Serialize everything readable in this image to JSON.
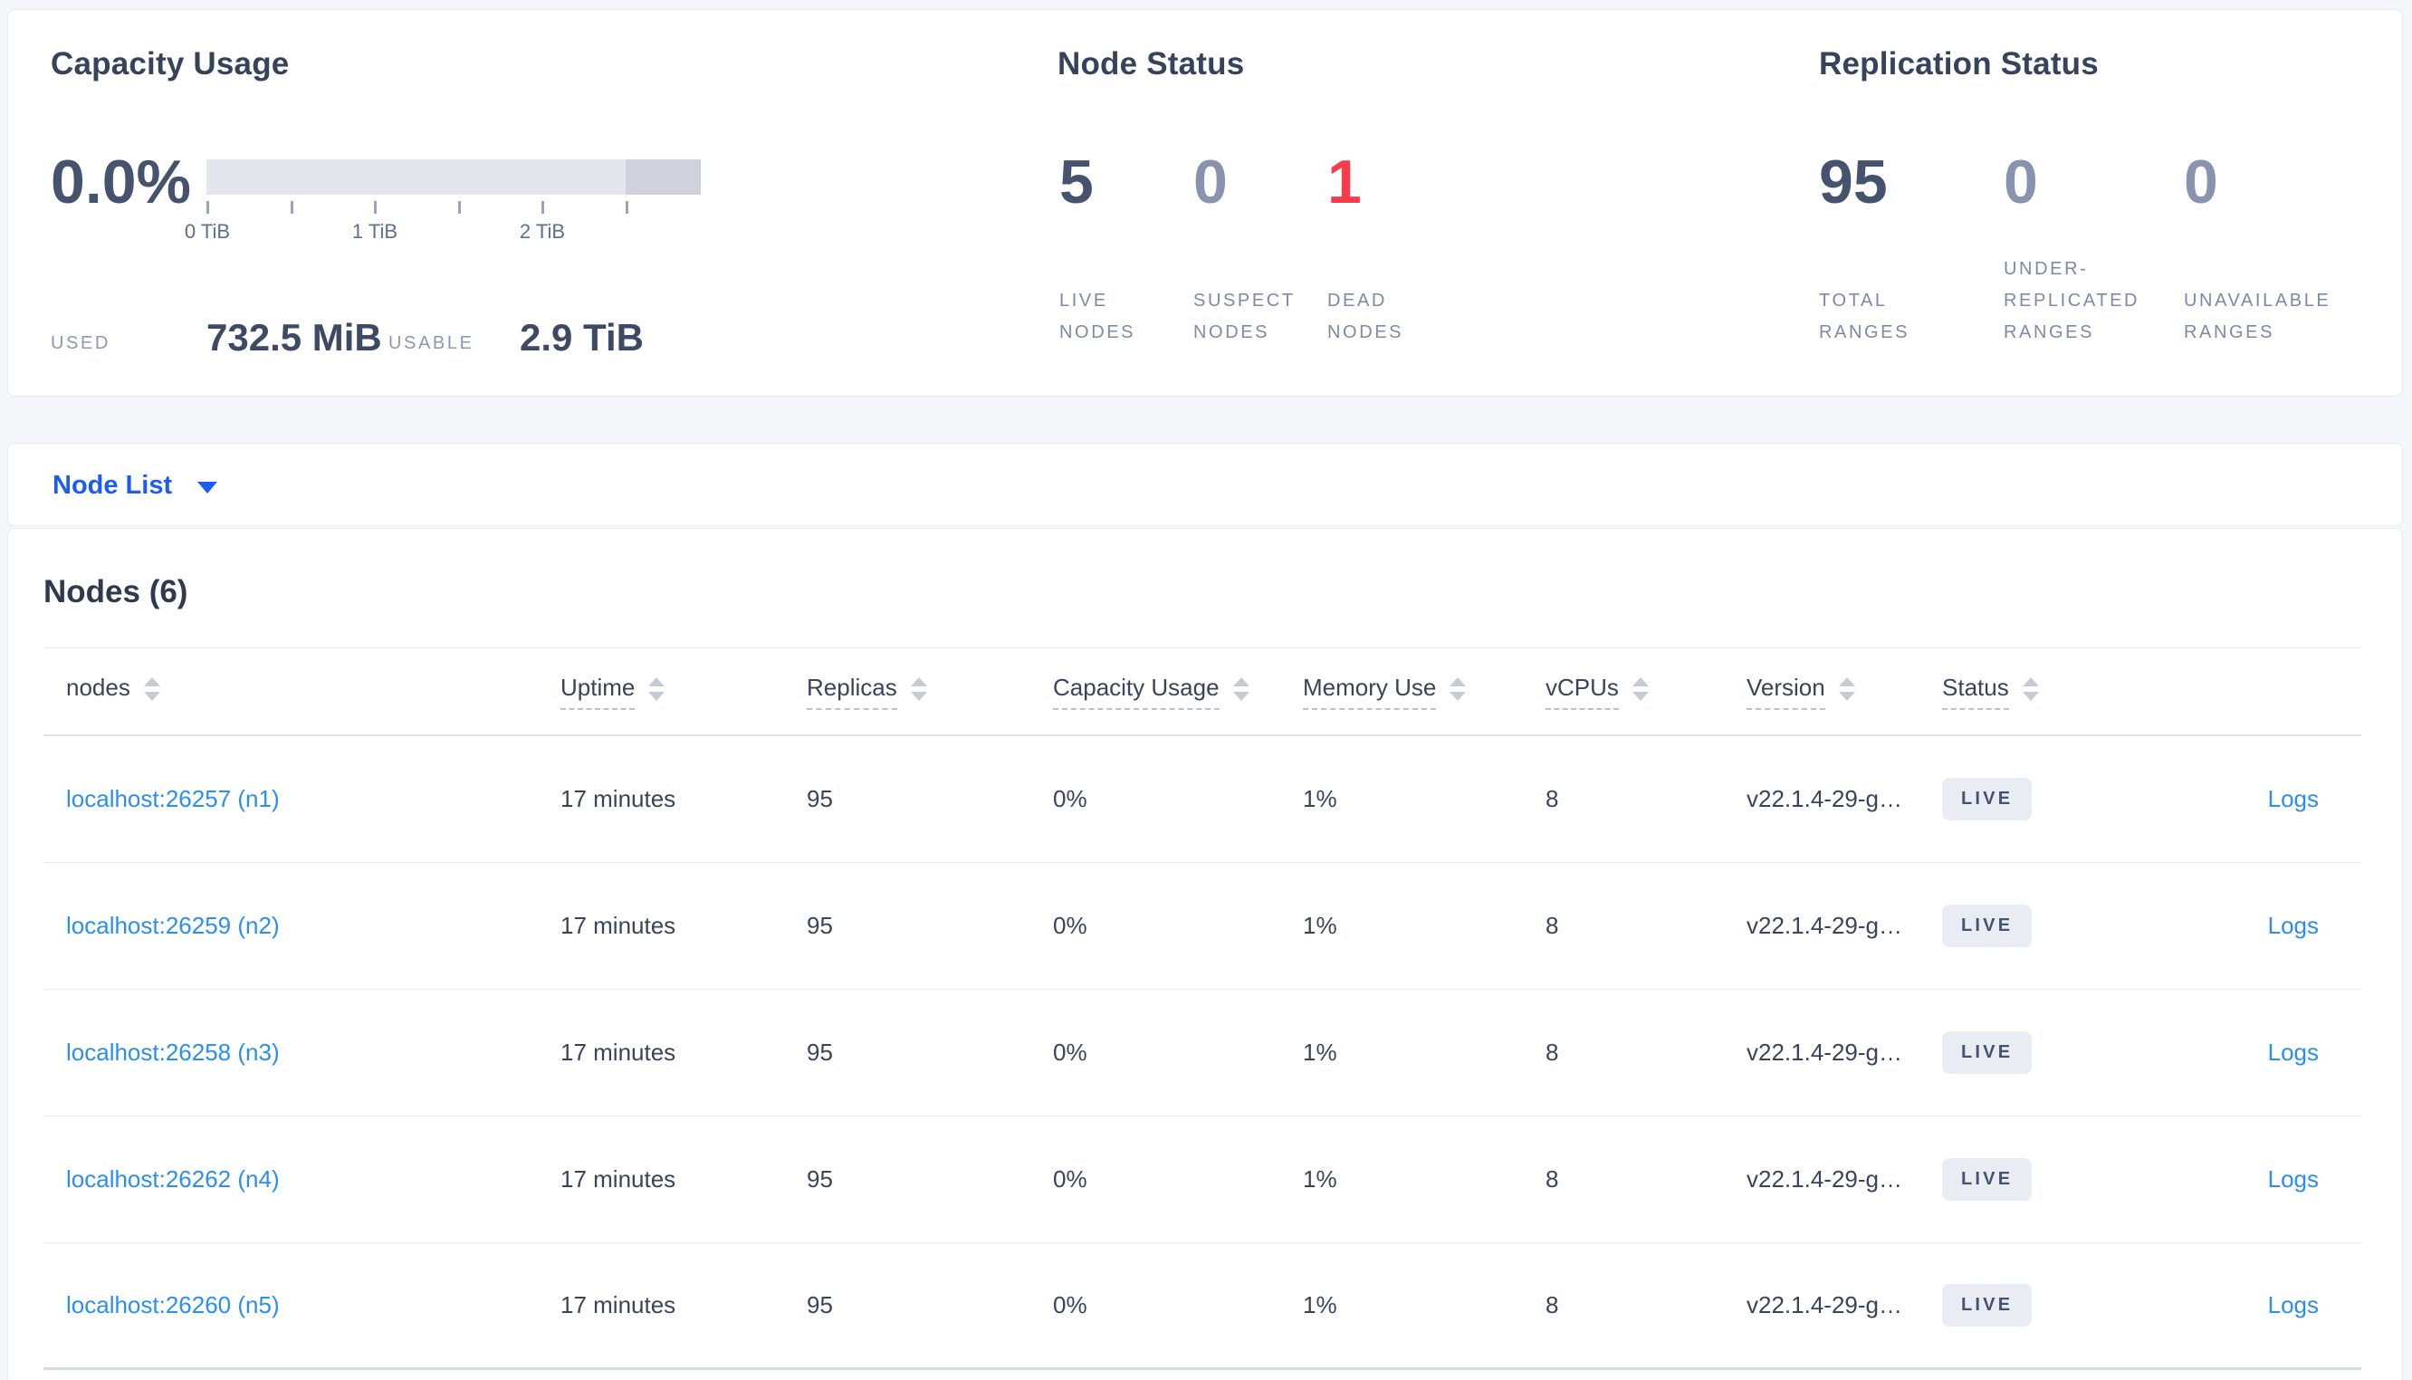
{
  "summary": {
    "capacity": {
      "title": "Capacity Usage",
      "percent": "0.0%",
      "tick_labels": [
        "0 TiB",
        "1 TiB",
        "2 TiB"
      ],
      "used_label": "USED",
      "used_value": "732.5 MiB",
      "usable_label": "USABLE",
      "usable_value": "2.9 TiB"
    },
    "node_status": {
      "title": "Node Status",
      "metrics": [
        {
          "value": "5",
          "label": "LIVE\nNODES"
        },
        {
          "value": "0",
          "label": "SUSPECT\nNODES"
        },
        {
          "value": "1",
          "label": "DEAD\nNODES"
        }
      ]
    },
    "replication_status": {
      "title": "Replication Status",
      "metrics": [
        {
          "value": "95",
          "label": "TOTAL\nRANGES"
        },
        {
          "value": "0",
          "label": "UNDER-\nREPLICATED\nRANGES"
        },
        {
          "value": "0",
          "label": "UNAVAILABLE\nRANGES"
        }
      ]
    }
  },
  "view_selector": {
    "label": "Node List"
  },
  "nodes_table": {
    "title": "Nodes (6)",
    "columns": [
      {
        "key": "node",
        "label": "nodes",
        "sortable": true,
        "tooltip": false
      },
      {
        "key": "uptime",
        "label": "Uptime",
        "sortable": true,
        "tooltip": true
      },
      {
        "key": "replicas",
        "label": "Replicas",
        "sortable": true,
        "tooltip": true
      },
      {
        "key": "capacity",
        "label": "Capacity Usage",
        "sortable": true,
        "tooltip": true
      },
      {
        "key": "memory",
        "label": "Memory Use",
        "sortable": true,
        "tooltip": true
      },
      {
        "key": "vcpus",
        "label": "vCPUs",
        "sortable": true,
        "tooltip": true
      },
      {
        "key": "version",
        "label": "Version",
        "sortable": true,
        "tooltip": true
      },
      {
        "key": "status",
        "label": "Status",
        "sortable": true,
        "tooltip": true
      },
      {
        "key": "logs",
        "label": "",
        "sortable": false,
        "tooltip": false
      }
    ],
    "rows": [
      {
        "node": "localhost:26257 (n1)",
        "uptime": "17 minutes",
        "replicas": "95",
        "capacity": "0%",
        "memory": "1%",
        "vcpus": "8",
        "version": "v22.1.4-29-g…",
        "status": "LIVE",
        "logs": "Logs"
      },
      {
        "node": "localhost:26259 (n2)",
        "uptime": "17 minutes",
        "replicas": "95",
        "capacity": "0%",
        "memory": "1%",
        "vcpus": "8",
        "version": "v22.1.4-29-g…",
        "status": "LIVE",
        "logs": "Logs"
      },
      {
        "node": "localhost:26258 (n3)",
        "uptime": "17 minutes",
        "replicas": "95",
        "capacity": "0%",
        "memory": "1%",
        "vcpus": "8",
        "version": "v22.1.4-29-g…",
        "status": "LIVE",
        "logs": "Logs"
      },
      {
        "node": "localhost:26262 (n4)",
        "uptime": "17 minutes",
        "replicas": "95",
        "capacity": "0%",
        "memory": "1%",
        "vcpus": "8",
        "version": "v22.1.4-29-g…",
        "status": "LIVE",
        "logs": "Logs"
      },
      {
        "node": "localhost:26260 (n5)",
        "uptime": "17 minutes",
        "replicas": "95",
        "capacity": "0%",
        "memory": "1%",
        "vcpus": "8",
        "version": "v22.1.4-29-g…",
        "status": "LIVE",
        "logs": "Logs"
      }
    ]
  },
  "colors": {
    "page_background": "#f4f6fa",
    "accent_blue": "#1d5cf0",
    "link_blue": "#2b8ef3",
    "danger_red": "#fb3b4b",
    "dark_slate": "#46536e",
    "muted_slate": "#8893b0",
    "label_slate": "#7e89a6",
    "badge_background": "#e9edf3",
    "capacity_bar_light": "#e4e6ed",
    "capacity_bar_dark": "#cfd2dd"
  }
}
